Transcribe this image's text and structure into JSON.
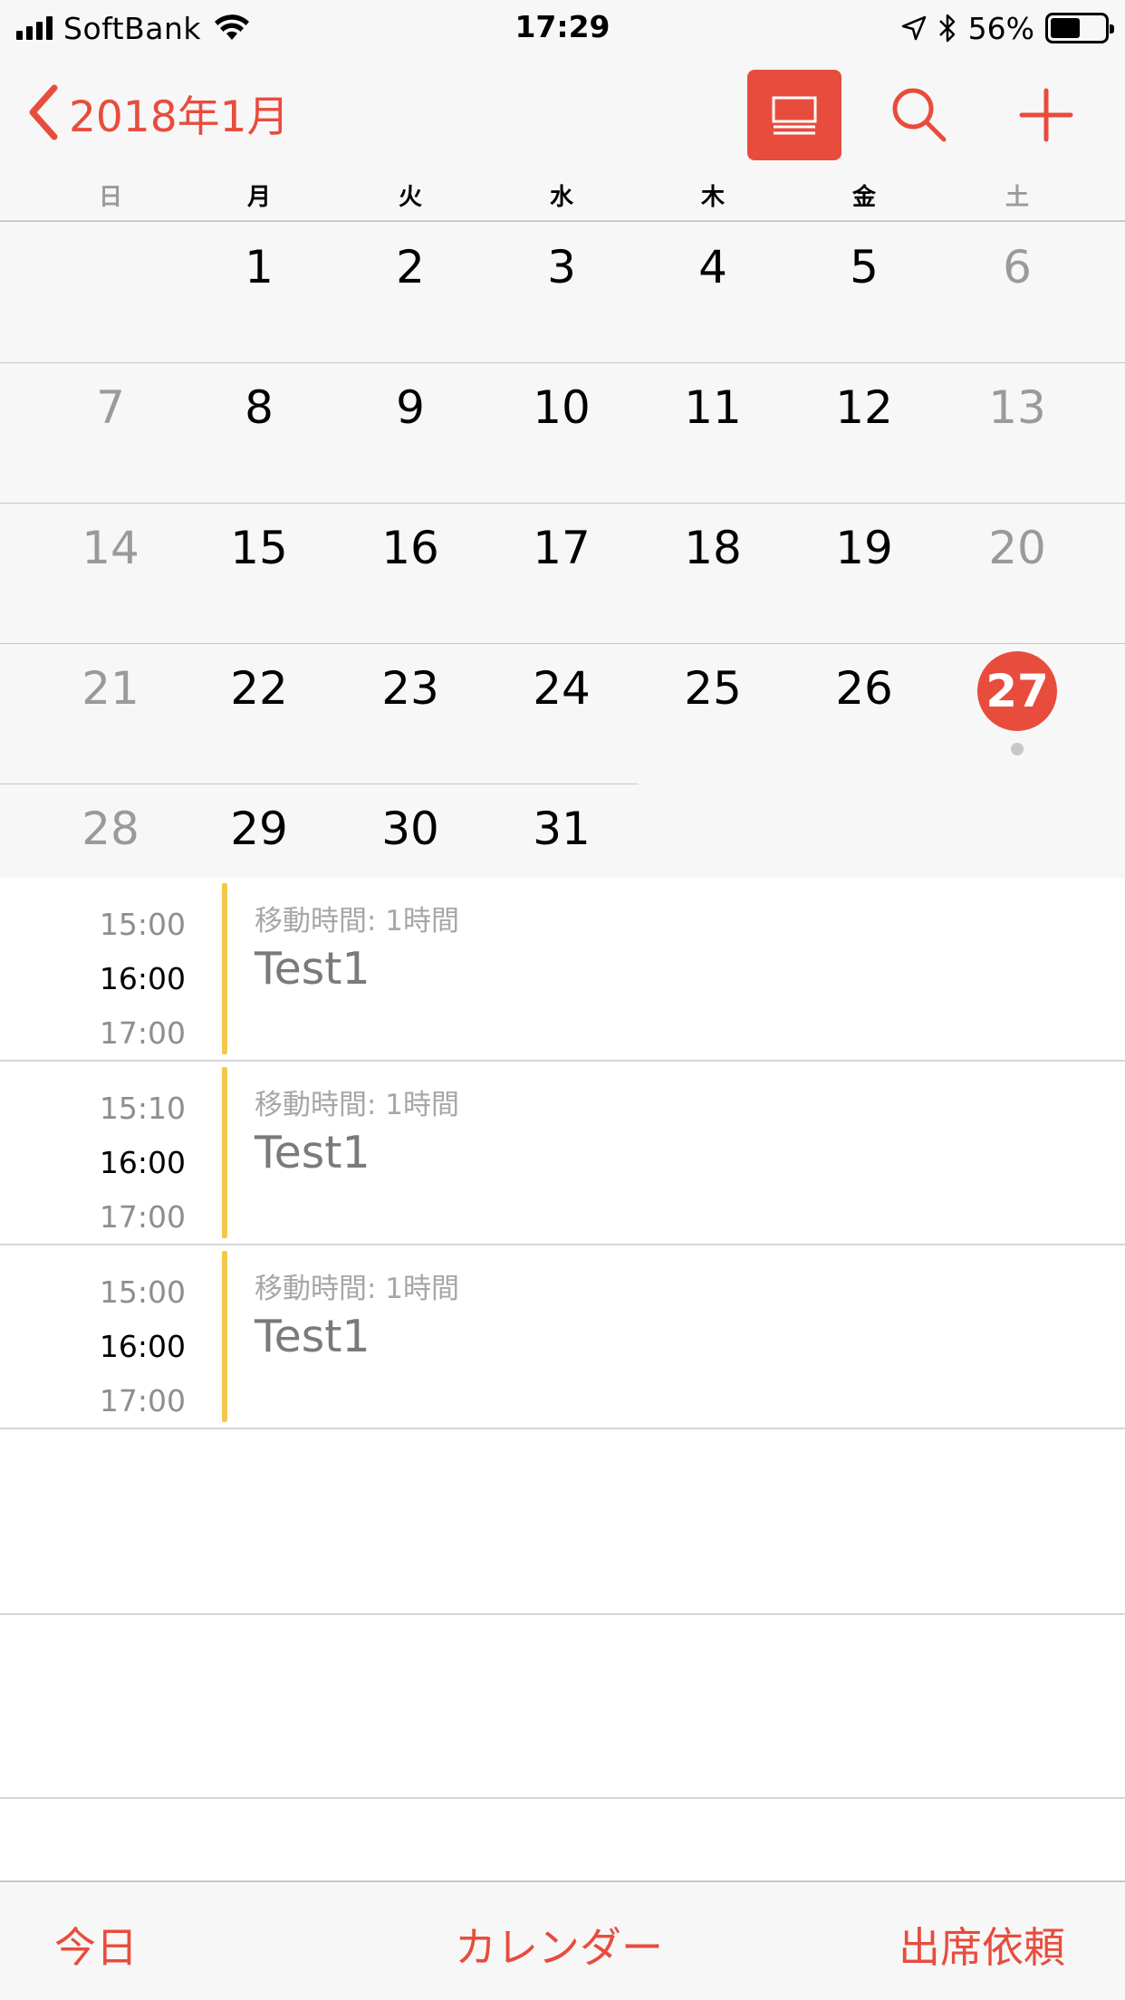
{
  "status_bar": {
    "carrier": "SoftBank",
    "time": "17:29",
    "battery_percent": "56%",
    "battery_level": 0.56
  },
  "header": {
    "back_label": "2018年1月",
    "accent_color": "#e84c3d"
  },
  "weekdays": [
    "日",
    "月",
    "火",
    "水",
    "木",
    "金",
    "土"
  ],
  "calendar": {
    "today": "27",
    "weeks": [
      [
        "",
        "1",
        "2",
        "3",
        "4",
        "5",
        "6"
      ],
      [
        "7",
        "8",
        "9",
        "10",
        "11",
        "12",
        "13"
      ],
      [
        "14",
        "15",
        "16",
        "17",
        "18",
        "19",
        "20"
      ],
      [
        "21",
        "22",
        "23",
        "24",
        "25",
        "26",
        "27"
      ],
      [
        "28",
        "29",
        "30",
        "31",
        "",
        "",
        ""
      ]
    ]
  },
  "events": [
    {
      "start": "15:00",
      "main": "16:00",
      "end": "17:00",
      "travel": "移動時間: 1時間",
      "title": "Test1",
      "color": "#f2c94c"
    },
    {
      "start": "15:10",
      "main": "16:00",
      "end": "17:00",
      "travel": "移動時間: 1時間",
      "title": "Test1",
      "color": "#f2c94c"
    },
    {
      "start": "15:00",
      "main": "16:00",
      "end": "17:00",
      "travel": "移動時間: 1時間",
      "title": "Test1",
      "color": "#f2c94c"
    }
  ],
  "tabbar": {
    "today": "今日",
    "calendars": "カレンダー",
    "inbox": "出席依頼"
  },
  "icons": {
    "back": "chevron-left-icon",
    "list": "list-view-icon",
    "search": "search-icon",
    "add": "plus-icon"
  }
}
